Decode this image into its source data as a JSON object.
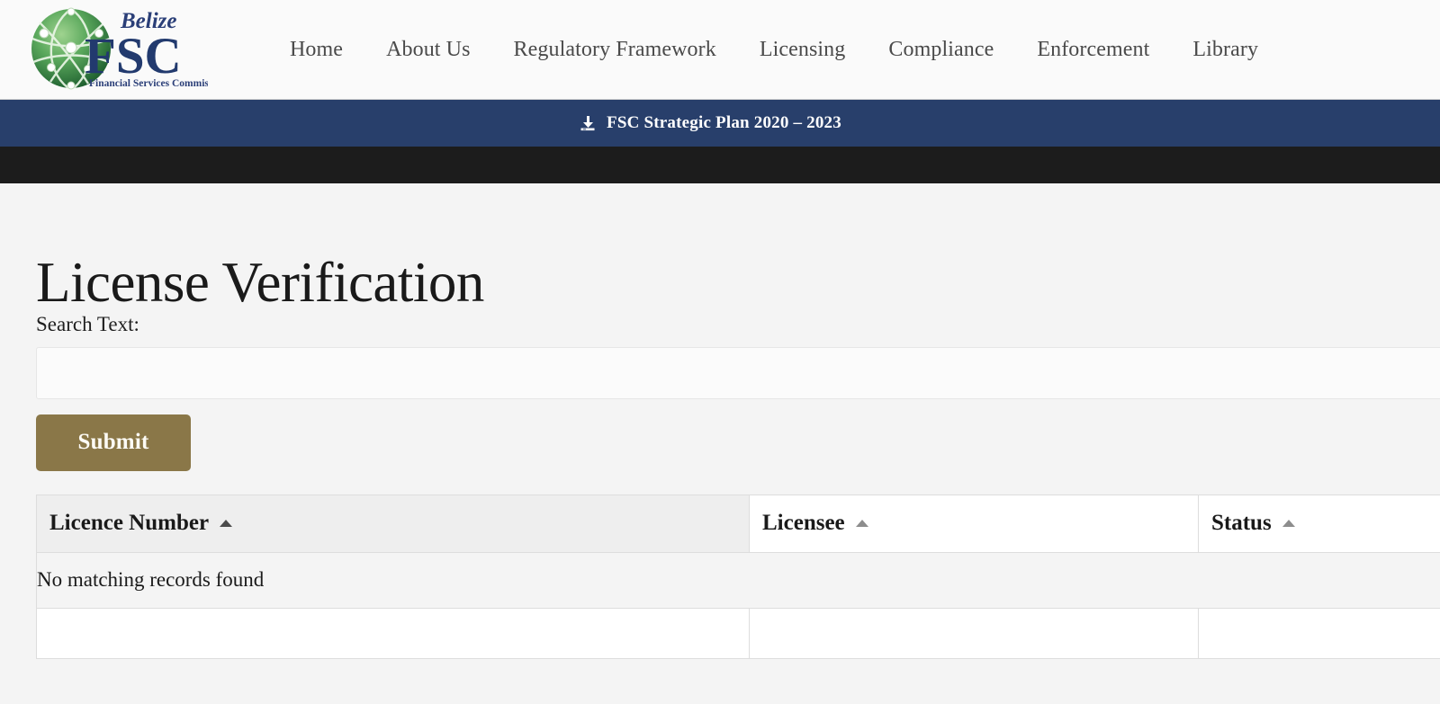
{
  "site": {
    "logo": {
      "brand_top": "Belize",
      "brand_main": "FSC",
      "brand_sub": "Financial Services Commission",
      "icon": "globe-network-icon"
    },
    "nav": [
      {
        "label": "Home",
        "name": "nav-home"
      },
      {
        "label": "About Us",
        "name": "nav-about-us"
      },
      {
        "label": "Regulatory Framework",
        "name": "nav-regulatory-framework"
      },
      {
        "label": "Licensing",
        "name": "nav-licensing"
      },
      {
        "label": "Compliance",
        "name": "nav-compliance"
      },
      {
        "label": "Enforcement",
        "name": "nav-enforcement"
      },
      {
        "label": "Library",
        "name": "nav-library"
      }
    ]
  },
  "strategic_bar": {
    "icon": "download-icon",
    "label": "FSC Strategic Plan 2020 – 2023",
    "background_color": "#283f6b",
    "text_color": "#ffffff"
  },
  "main": {
    "page_title": "License Verification",
    "search": {
      "label": "Search Text:",
      "value": "",
      "placeholder": ""
    },
    "submit": {
      "label": "Submit",
      "color": "#8a7748"
    }
  },
  "table": {
    "columns": [
      {
        "label": "Licence Number",
        "sort": "asc",
        "sorted": true,
        "name": "col-licence-number"
      },
      {
        "label": "Licensee",
        "sort": "asc",
        "sorted": false,
        "name": "col-licensee"
      },
      {
        "label": "Status",
        "sort": "asc",
        "sorted": false,
        "name": "col-status"
      }
    ],
    "rows": [],
    "empty_message": "No matching records found",
    "footer": [
      "",
      "",
      ""
    ]
  }
}
